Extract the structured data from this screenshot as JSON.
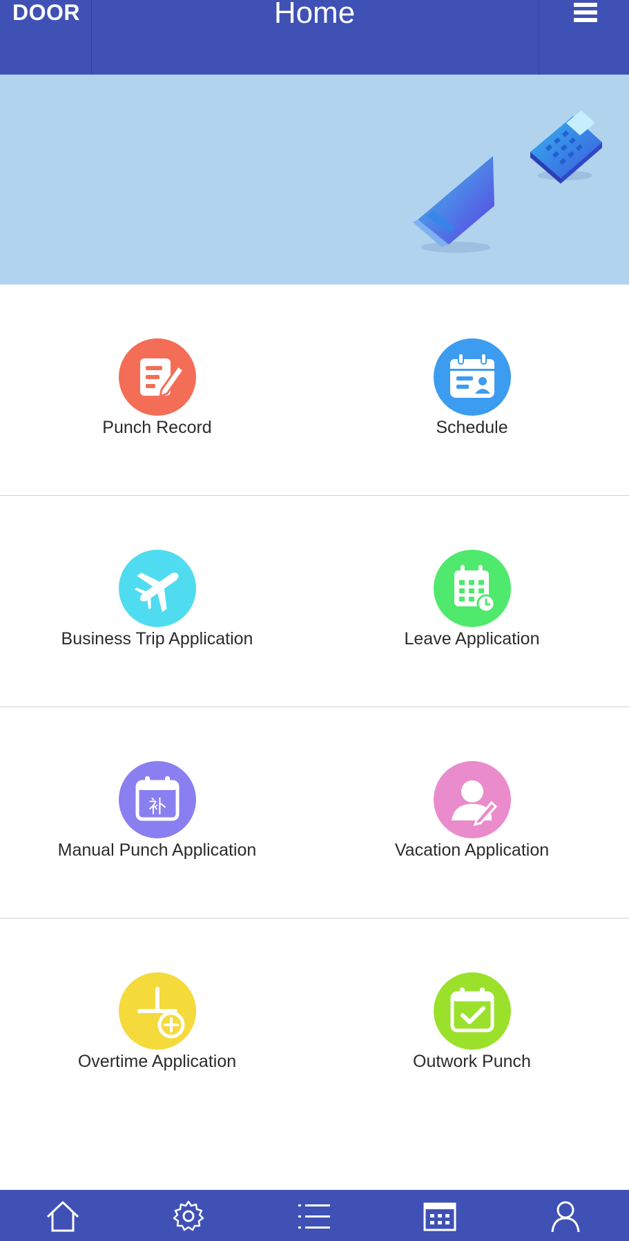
{
  "header": {
    "left_label": "DOOR",
    "title": "Home",
    "menu_icon": "hamburger-icon"
  },
  "banner": {
    "background": "#b1d3ee",
    "illustrations": [
      "laptop-icon",
      "calculator-icon"
    ]
  },
  "menu": [
    {
      "label": "Punch Record",
      "icon": "punch-record-icon",
      "color": "#f46d57"
    },
    {
      "label": "Schedule",
      "icon": "schedule-icon",
      "color": "#3c9cf0"
    },
    {
      "label": "Business Trip Application",
      "icon": "airplane-icon",
      "color": "#4fdcf0"
    },
    {
      "label": "Leave Application",
      "icon": "leave-calendar-icon",
      "color": "#4fe96d"
    },
    {
      "label": "Manual Punch Application",
      "icon": "manual-punch-icon",
      "color": "#8a7ff0",
      "icon_text": "补"
    },
    {
      "label": "Vacation Application",
      "icon": "vacation-icon",
      "color": "#ea8ccb"
    },
    {
      "label": "Overtime Application",
      "icon": "overtime-icon",
      "color": "#f5da3c"
    },
    {
      "label": "Outwork Punch",
      "icon": "outwork-punch-icon",
      "color": "#9be12b"
    }
  ],
  "bottom_nav": [
    "home-icon",
    "settings-icon",
    "list-icon",
    "calendar-icon",
    "profile-icon"
  ],
  "colors": {
    "primary": "#3f51b5",
    "label_text": "#2b2b2b",
    "divider": "#cfcfcf"
  }
}
